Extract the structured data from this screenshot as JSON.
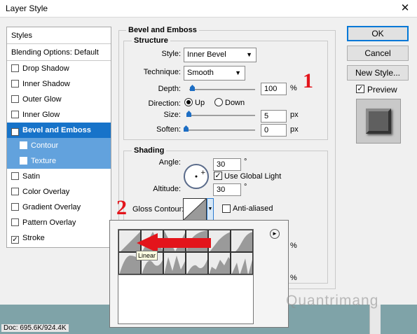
{
  "window": {
    "title": "Layer Style",
    "close_glyph": "✕"
  },
  "style_list": {
    "header": "Styles",
    "blending": "Blending Options: Default",
    "items": [
      {
        "label": "Drop Shadow",
        "checked": false
      },
      {
        "label": "Inner Shadow",
        "checked": false
      },
      {
        "label": "Outer Glow",
        "checked": false
      },
      {
        "label": "Inner Glow",
        "checked": false
      },
      {
        "label": "Bevel and Emboss",
        "checked": true
      },
      {
        "label": "Contour",
        "checked": false
      },
      {
        "label": "Texture",
        "checked": false
      },
      {
        "label": "Satin",
        "checked": false
      },
      {
        "label": "Color Overlay",
        "checked": false
      },
      {
        "label": "Gradient Overlay",
        "checked": false
      },
      {
        "label": "Pattern Overlay",
        "checked": false
      },
      {
        "label": "Stroke",
        "checked": true
      }
    ]
  },
  "bevel": {
    "title": "Bevel and Emboss",
    "structure_title": "Structure",
    "style_label": "Style:",
    "style_value": "Inner Bevel",
    "technique_label": "Technique:",
    "technique_value": "Smooth",
    "depth_label": "Depth:",
    "depth_value": "100",
    "depth_unit": "%",
    "direction_label": "Direction:",
    "direction_up": "Up",
    "direction_down": "Down",
    "size_label": "Size:",
    "size_value": "5",
    "size_unit": "px",
    "soften_label": "Soften:",
    "soften_value": "0",
    "soften_unit": "px"
  },
  "shading": {
    "title": "Shading",
    "angle_label": "Angle:",
    "angle_value": "30",
    "degree": "°",
    "global_light": "Use Global Light",
    "altitude_label": "Altitude:",
    "altitude_value": "30",
    "gloss_label": "Gloss Contour:",
    "anti_aliased": "Anti-aliased",
    "hidden_unit_1": "%",
    "hidden_unit_2": "%"
  },
  "buttons": {
    "ok": "OK",
    "cancel": "Cancel",
    "new_style": "New Style...",
    "preview": "Preview"
  },
  "annotations": {
    "one": "1",
    "two": "2"
  },
  "popup": {
    "tooltip": "Linear",
    "menu_glyph": "►"
  },
  "status": {
    "doc": "Doc: 695.6K/924.4K"
  },
  "watermark": "Quantrimang",
  "colors": {
    "selection": "#1773c9",
    "sub_selection": "#62a2dd",
    "annotation": "#e3141b",
    "accent": "#0078d7"
  }
}
